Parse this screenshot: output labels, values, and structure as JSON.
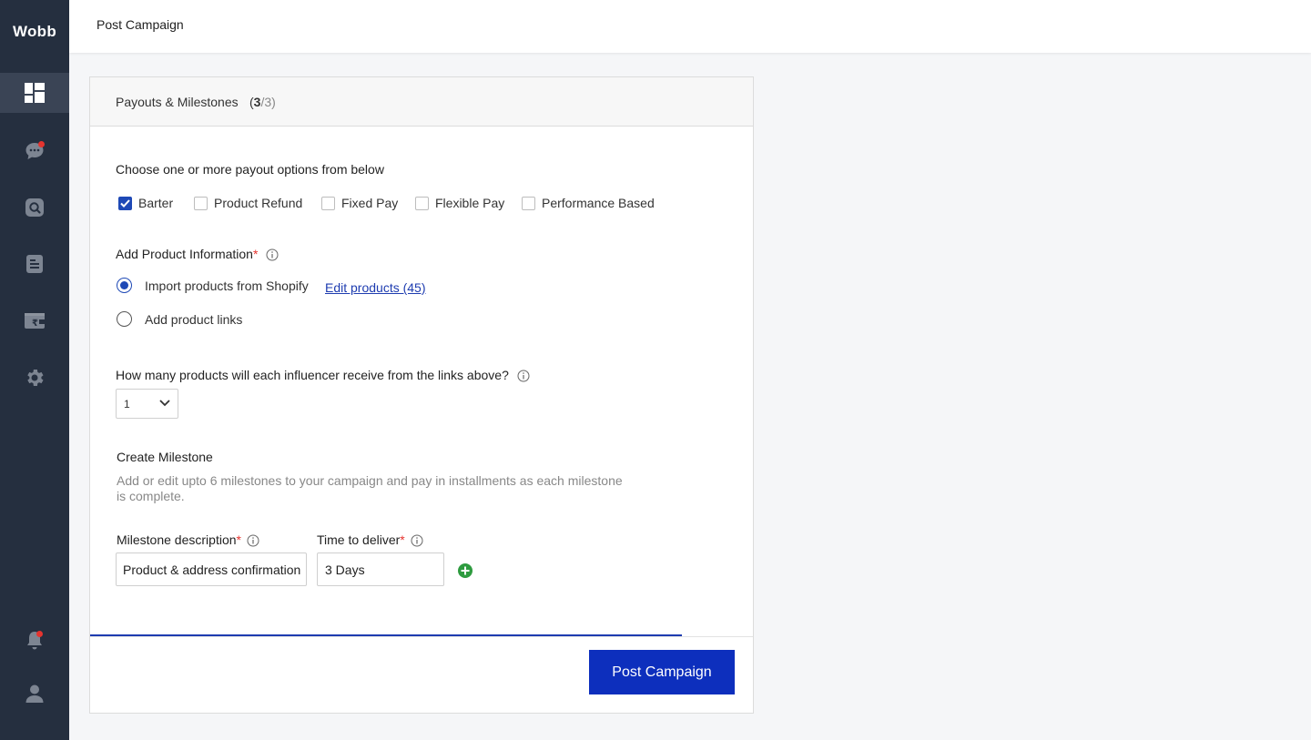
{
  "brand": {
    "name": "Wobb"
  },
  "sidebar": {
    "items": [
      {
        "icon": "dashboard-icon",
        "active": true
      },
      {
        "icon": "chat-icon",
        "badge": true
      },
      {
        "icon": "search-icon"
      },
      {
        "icon": "document-icon"
      },
      {
        "icon": "wallet-icon"
      },
      {
        "icon": "gear-icon"
      }
    ],
    "bottom": [
      {
        "icon": "bell-icon",
        "badge": true
      },
      {
        "icon": "user-icon"
      }
    ]
  },
  "topbar": {
    "title": "Post Campaign"
  },
  "card": {
    "title": "Payouts & Milestones",
    "step_open": "(",
    "step_current": "3",
    "step_total": "/3)"
  },
  "payout": {
    "prompt": "Choose one or more payout options from below",
    "options": [
      {
        "label": "Barter",
        "checked": true
      },
      {
        "label": "Product Refund",
        "checked": false
      },
      {
        "label": "Fixed Pay",
        "checked": false
      },
      {
        "label": "Flexible Pay",
        "checked": false
      },
      {
        "label": "Performance Based",
        "checked": false
      }
    ]
  },
  "product_info": {
    "label": "Add Product Information",
    "required_mark": "*",
    "options": [
      {
        "label": "Import products from Shopify",
        "selected": true
      },
      {
        "label": "Add product links",
        "selected": false
      }
    ],
    "edit_link": "Edit products (45)"
  },
  "quantity": {
    "question": "How many products will each influencer receive from the links above?",
    "value": "1"
  },
  "milestone": {
    "title": "Create Milestone",
    "description": "Add or edit upto 6 milestones to your campaign and pay in installments as each milestone is complete.",
    "desc_label": "Milestone description",
    "time_label": "Time to deliver",
    "required_mark": "*",
    "desc_value": "Product & address confirmation",
    "time_value": "3 Days"
  },
  "footer": {
    "post_label": "Post Campaign"
  },
  "colors": {
    "sidebar": "#252f3f",
    "primary": "#0d2fbd",
    "accent_green": "#2e9b3f",
    "badge_red": "#e5342f"
  }
}
